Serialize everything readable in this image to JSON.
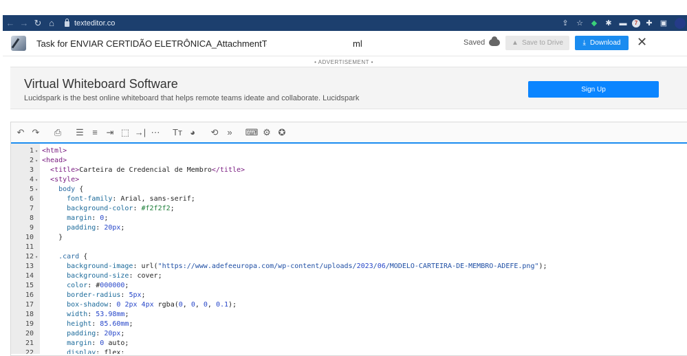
{
  "browser": {
    "url": "texteditor.co"
  },
  "doc": {
    "title": "Task for ENVIAR CERTIDÃO ELETRÔNICA_AttachmentTemplat",
    "extension": "ml",
    "saved_label": "Saved",
    "save_to_drive_label": "Save to Drive",
    "download_label": "Download"
  },
  "ad": {
    "label": "• ADVERTISEMENT •",
    "title": "Virtual Whiteboard Software",
    "text": "Lucidspark is the best online whiteboard that helps remote teams ideate and collaborate. Lucidspark",
    "cta": "Sign Up"
  },
  "toolbar": {
    "icons": [
      "undo-icon",
      "redo-icon",
      "print-icon",
      "numbered-list-icon",
      "wrap-icon",
      "indent-icon",
      "select-all-icon",
      "tab-icon",
      "more-icon",
      "font-size-icon",
      "palette-icon",
      "search-replace-icon",
      "fast-forward-icon",
      "keyboard-icon",
      "gear-icon",
      "star-icon"
    ]
  },
  "code": {
    "lines": [
      {
        "n": "1",
        "fold": true,
        "text": "<html>"
      },
      {
        "n": "2",
        "fold": true,
        "text": "<head>"
      },
      {
        "n": "3",
        "fold": false,
        "text": "  <title>Carteira de Credencial de Membro</title>"
      },
      {
        "n": "4",
        "fold": true,
        "text": "  <style>"
      },
      {
        "n": "5",
        "fold": true,
        "text": "    body {"
      },
      {
        "n": "6",
        "fold": false,
        "text": "      font-family: Arial, sans-serif;"
      },
      {
        "n": "7",
        "fold": false,
        "text": "      background-color: #f2f2f2;"
      },
      {
        "n": "8",
        "fold": false,
        "text": "      margin: 0;"
      },
      {
        "n": "9",
        "fold": false,
        "text": "      padding: 20px;"
      },
      {
        "n": "10",
        "fold": false,
        "text": "    }"
      },
      {
        "n": "11",
        "fold": false,
        "text": ""
      },
      {
        "n": "12",
        "fold": true,
        "text": "    .card {"
      },
      {
        "n": "13",
        "fold": false,
        "text": "      background-image: url(\"https://www.adefeeuropa.com/wp-content/uploads/2023/06/MODELO-CARTEIRA-DE-MEMBRO-ADEFE.png\");"
      },
      {
        "n": "14",
        "fold": false,
        "text": "      background-size: cover;"
      },
      {
        "n": "15",
        "fold": false,
        "text": "      color: #000000;"
      },
      {
        "n": "16",
        "fold": false,
        "text": "      border-radius: 5px;"
      },
      {
        "n": "17",
        "fold": false,
        "text": "      box-shadow: 0 2px 4px rgba(0, 0, 0, 0.1);"
      },
      {
        "n": "18",
        "fold": false,
        "text": "      width: 53.98mm;"
      },
      {
        "n": "19",
        "fold": false,
        "text": "      height: 85.60mm;"
      },
      {
        "n": "20",
        "fold": false,
        "text": "      padding: 20px;"
      },
      {
        "n": "21",
        "fold": false,
        "text": "      margin: 0 auto;"
      },
      {
        "n": "22",
        "fold": false,
        "text": "      display: flex;"
      }
    ]
  }
}
